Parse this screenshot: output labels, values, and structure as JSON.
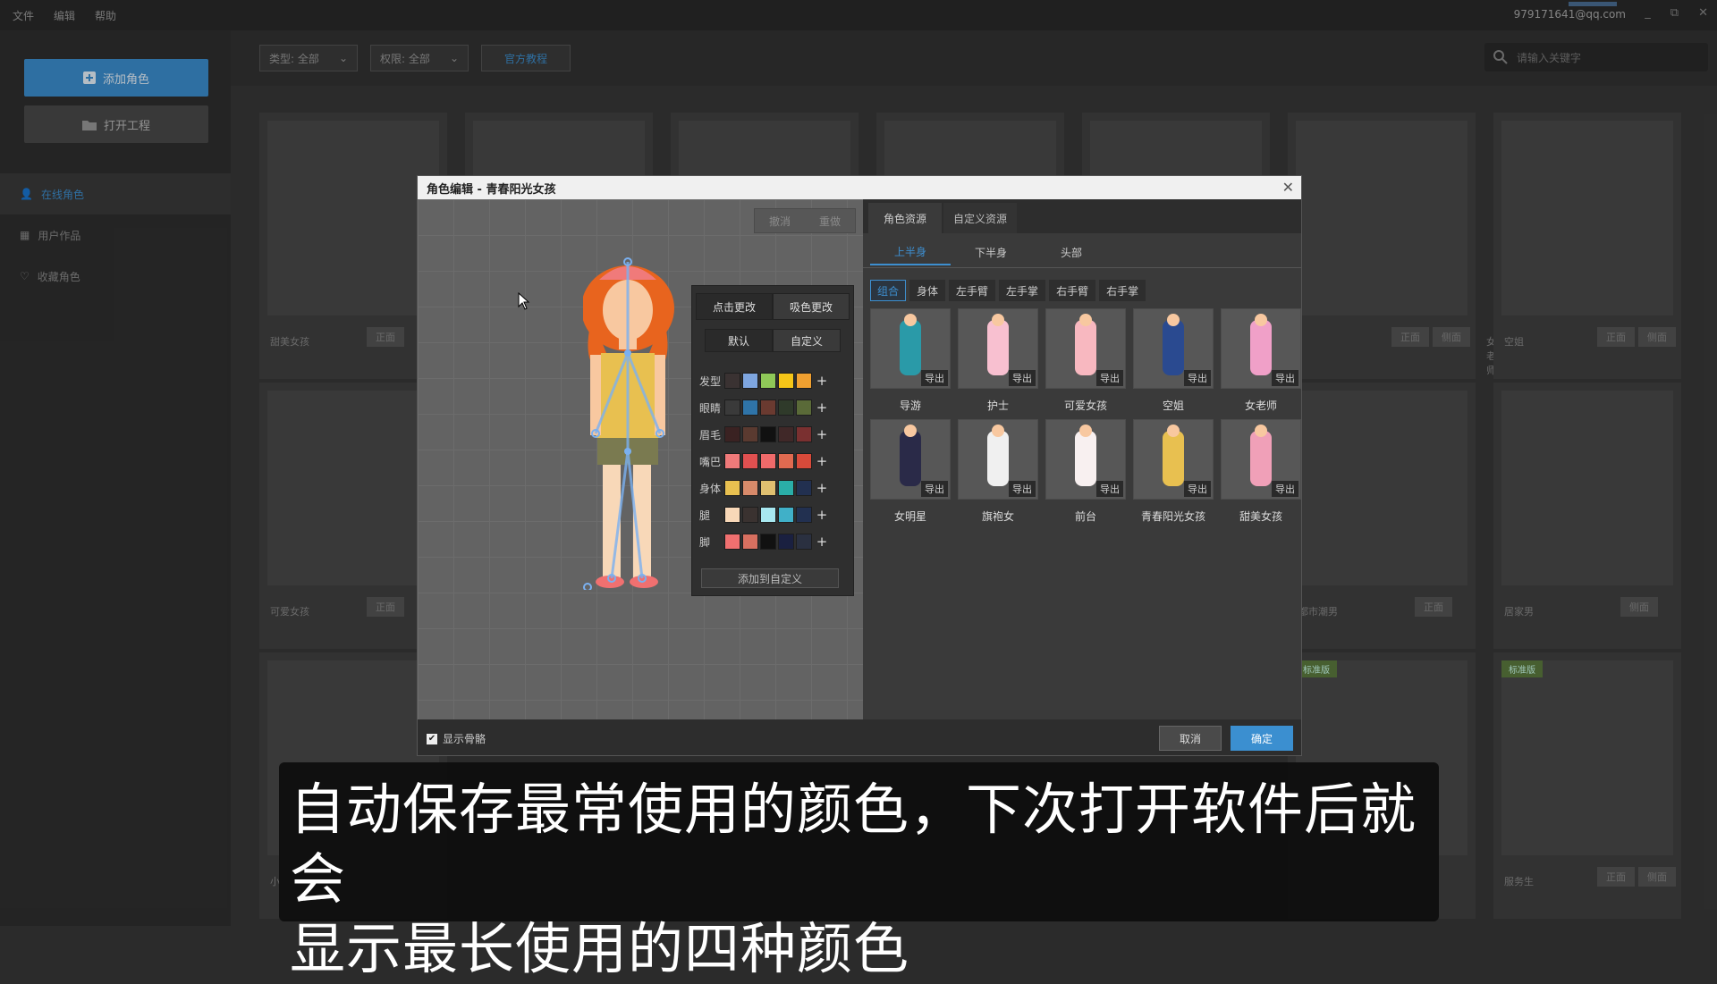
{
  "topbar": {
    "menu": [
      "文件",
      "编辑",
      "帮助"
    ],
    "account": "979171641@qq.com",
    "controls": [
      "_",
      "⧉",
      "✕"
    ]
  },
  "sidebar": {
    "add_label": "添加角色",
    "open_label": "打开工程",
    "nav": [
      {
        "label": "在线角色",
        "icon": "user-icon"
      },
      {
        "label": "用户作品",
        "icon": "grid-icon"
      },
      {
        "label": "收藏角色",
        "icon": "heart-icon"
      }
    ]
  },
  "filters": {
    "type": "类型: 全部",
    "perm": "权限: 全部",
    "tutorial": "官方教程",
    "search_placeholder": "请输入关键字"
  },
  "cards": {
    "row1": [
      "甜美女孩",
      "",
      "",
      "",
      "",
      "女老师",
      "空姐"
    ],
    "row2": [
      "可爱女孩",
      "都市潮男",
      "居家男"
    ],
    "row3": [
      "小",
      "服务生"
    ],
    "front": "正面",
    "side": "侧面",
    "badge": "标准版"
  },
  "dialog": {
    "title": "角色编辑 - 青春阳光女孩",
    "undo": "撤消",
    "redo": "重做",
    "color_panel": {
      "tabs": [
        "点击更改",
        "吸色更改"
      ],
      "subtabs": [
        "默认",
        "自定义"
      ],
      "rows": [
        {
          "label": "发型",
          "colors": [
            "#3a3232",
            "#7ea6e0",
            "#8fc858",
            "#f5c518",
            "#f0a030"
          ]
        },
        {
          "label": "眼睛",
          "colors": [
            "#3a3a3a",
            "#2f74a8",
            "#6a3a30",
            "#2f3a2a",
            "#5a6a38"
          ]
        },
        {
          "label": "眉毛",
          "colors": [
            "#3a2222",
            "#5a3a30",
            "#111111",
            "#402828",
            "#7a3030"
          ]
        },
        {
          "label": "嘴巴",
          "colors": [
            "#f07a7a",
            "#e05050",
            "#f06a6a",
            "#e06a50",
            "#d84a3a"
          ]
        },
        {
          "label": "身体",
          "colors": [
            "#e8c050",
            "#d88a6a",
            "#e0c070",
            "#2aaea8",
            "#223050"
          ]
        },
        {
          "label": "腿",
          "colors": [
            "#f8d8b8",
            "#3a3230",
            "#a8e8f0",
            "#40b0c8",
            "#223050"
          ]
        },
        {
          "label": "脚",
          "colors": [
            "#f07070",
            "#d87060",
            "#111111",
            "#1a2040",
            "#2a3040"
          ]
        }
      ],
      "add_custom": "添加到自定义"
    },
    "right_tabs": [
      "角色资源",
      "自定义资源"
    ],
    "sub_tabs": [
      "上半身",
      "下半身",
      "头部"
    ],
    "chips": [
      "组合",
      "身体",
      "左手臂",
      "左手掌",
      "右手臂",
      "右手掌"
    ],
    "items": [
      "导游",
      "护士",
      "可爱女孩",
      "空姐",
      "女老师",
      "女明星",
      "旗袍女",
      "前台",
      "青春阳光女孩",
      "甜美女孩"
    ],
    "export": "导出",
    "show_bones": "显示骨骼",
    "cancel": "取消",
    "ok": "确定"
  },
  "subtitle": {
    "line1": "自动保存最常使用的颜色，下次打开软件后就会",
    "line2": "显示最长使用的四种颜色"
  }
}
